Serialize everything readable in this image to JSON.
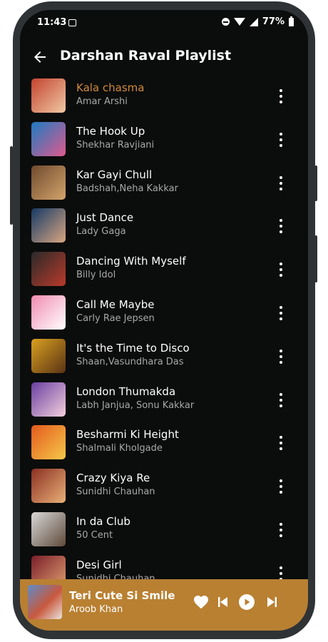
{
  "status_bar": {
    "time": "11:43",
    "battery": "77%"
  },
  "header": {
    "title": "Darshan Raval Playlist",
    "back_icon": "arrow-left-icon"
  },
  "songs": [
    {
      "title": "Kala chasma",
      "artist": "Amar Arshi",
      "active": true,
      "thumb_colors": [
        "#c3432f",
        "#f0c9a4"
      ]
    },
    {
      "title": "The Hook Up",
      "artist": "Shekhar Ravjiani",
      "active": false,
      "thumb_colors": [
        "#1c7bc2",
        "#e05a8d"
      ]
    },
    {
      "title": "Kar Gayi Chull",
      "artist": "Badshah,Neha Kakkar",
      "active": false,
      "thumb_colors": [
        "#6f4a2e",
        "#d3a46b"
      ]
    },
    {
      "title": "Just Dance",
      "artist": "Lady Gaga",
      "active": false,
      "thumb_colors": [
        "#153a66",
        "#d9a680"
      ]
    },
    {
      "title": "Dancing With Myself",
      "artist": "Billy Idol",
      "active": false,
      "thumb_colors": [
        "#2a2a2a",
        "#b93a2b"
      ]
    },
    {
      "title": "Call Me Maybe",
      "artist": "Carly Rae Jepsen",
      "active": false,
      "thumb_colors": [
        "#f08bb0",
        "#ffffff"
      ]
    },
    {
      "title": "It's the Time to Disco",
      "artist": "Shaan,Vasundhara Das",
      "active": false,
      "thumb_colors": [
        "#d9a020",
        "#5a3314"
      ]
    },
    {
      "title": "London Thumakda",
      "artist": "Labh Janjua, Sonu Kakkar",
      "active": false,
      "thumb_colors": [
        "#6a3fa0",
        "#f3d0dd"
      ]
    },
    {
      "title": "Besharmi Ki Height",
      "artist": "Shalmali Kholgade",
      "active": false,
      "thumb_colors": [
        "#e35a1d",
        "#f6c84a"
      ]
    },
    {
      "title": "Crazy Kiya Re",
      "artist": "Sunidhi Chauhan",
      "active": false,
      "thumb_colors": [
        "#8b2f22",
        "#e9b178"
      ]
    },
    {
      "title": "In da Club",
      "artist": "50 Cent",
      "active": false,
      "thumb_colors": [
        "#d8d8d8",
        "#5e4a3a"
      ]
    },
    {
      "title": "Desi Girl",
      "artist": "Sunidhi Chauhan",
      "active": false,
      "thumb_colors": [
        "#7b1e2a",
        "#e0a070"
      ]
    }
  ],
  "now_playing": {
    "title": "Teri Cute Si Smile",
    "artist": "Aroob Khan"
  },
  "colors": {
    "background": "#0b0c0c",
    "accent": "#d08a3a",
    "player_bar": "#b98032"
  }
}
